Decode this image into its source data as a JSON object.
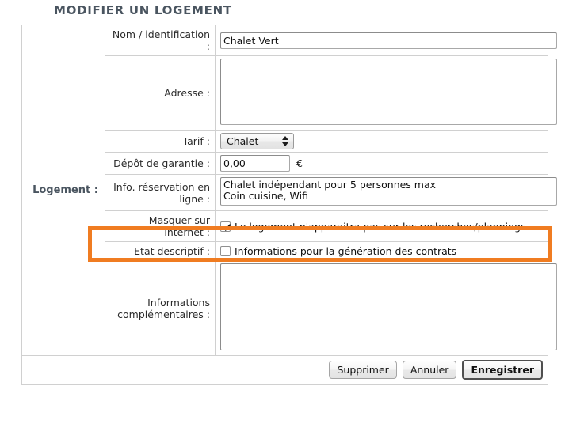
{
  "page": {
    "title": "MODIFIER UN LOGEMENT"
  },
  "form": {
    "section_label": "Logement :",
    "rows": {
      "nom": {
        "label": "Nom / identification :",
        "value": "Chalet Vert"
      },
      "adresse": {
        "label": "Adresse :",
        "value": ""
      },
      "tarif": {
        "label": "Tarif :",
        "selected": "Chalet",
        "options": [
          "Chalet"
        ]
      },
      "depot": {
        "label": "Dépôt de garantie :",
        "value": "0,00",
        "currency": "€"
      },
      "info_reservation": {
        "label": "Info. réservation en ligne :",
        "value": "Chalet indépendant pour 5 personnes max\nCoin cuisine, Wifi"
      },
      "masquer": {
        "label": "Masquer sur internet :",
        "checkbox_label": "Le logement n'apparaitra pas sur les recherches/plannings",
        "checked": true
      },
      "etat_descriptif": {
        "label": "Etat descriptif :",
        "checkbox_label": "Informations pour la génération des contrats",
        "checked": false
      },
      "informations_complementaires": {
        "label": "Informations complémentaires :",
        "value": ""
      }
    },
    "buttons": {
      "delete": "Supprimer",
      "cancel": "Annuler",
      "save": "Enregistrer"
    }
  },
  "highlight": {
    "color": "#f07c21",
    "target": "masquer-sur-internet-row"
  },
  "colors": {
    "title": "#4a5560",
    "accent": "#f07c21",
    "border": "#cccccc",
    "text": "#111111"
  }
}
